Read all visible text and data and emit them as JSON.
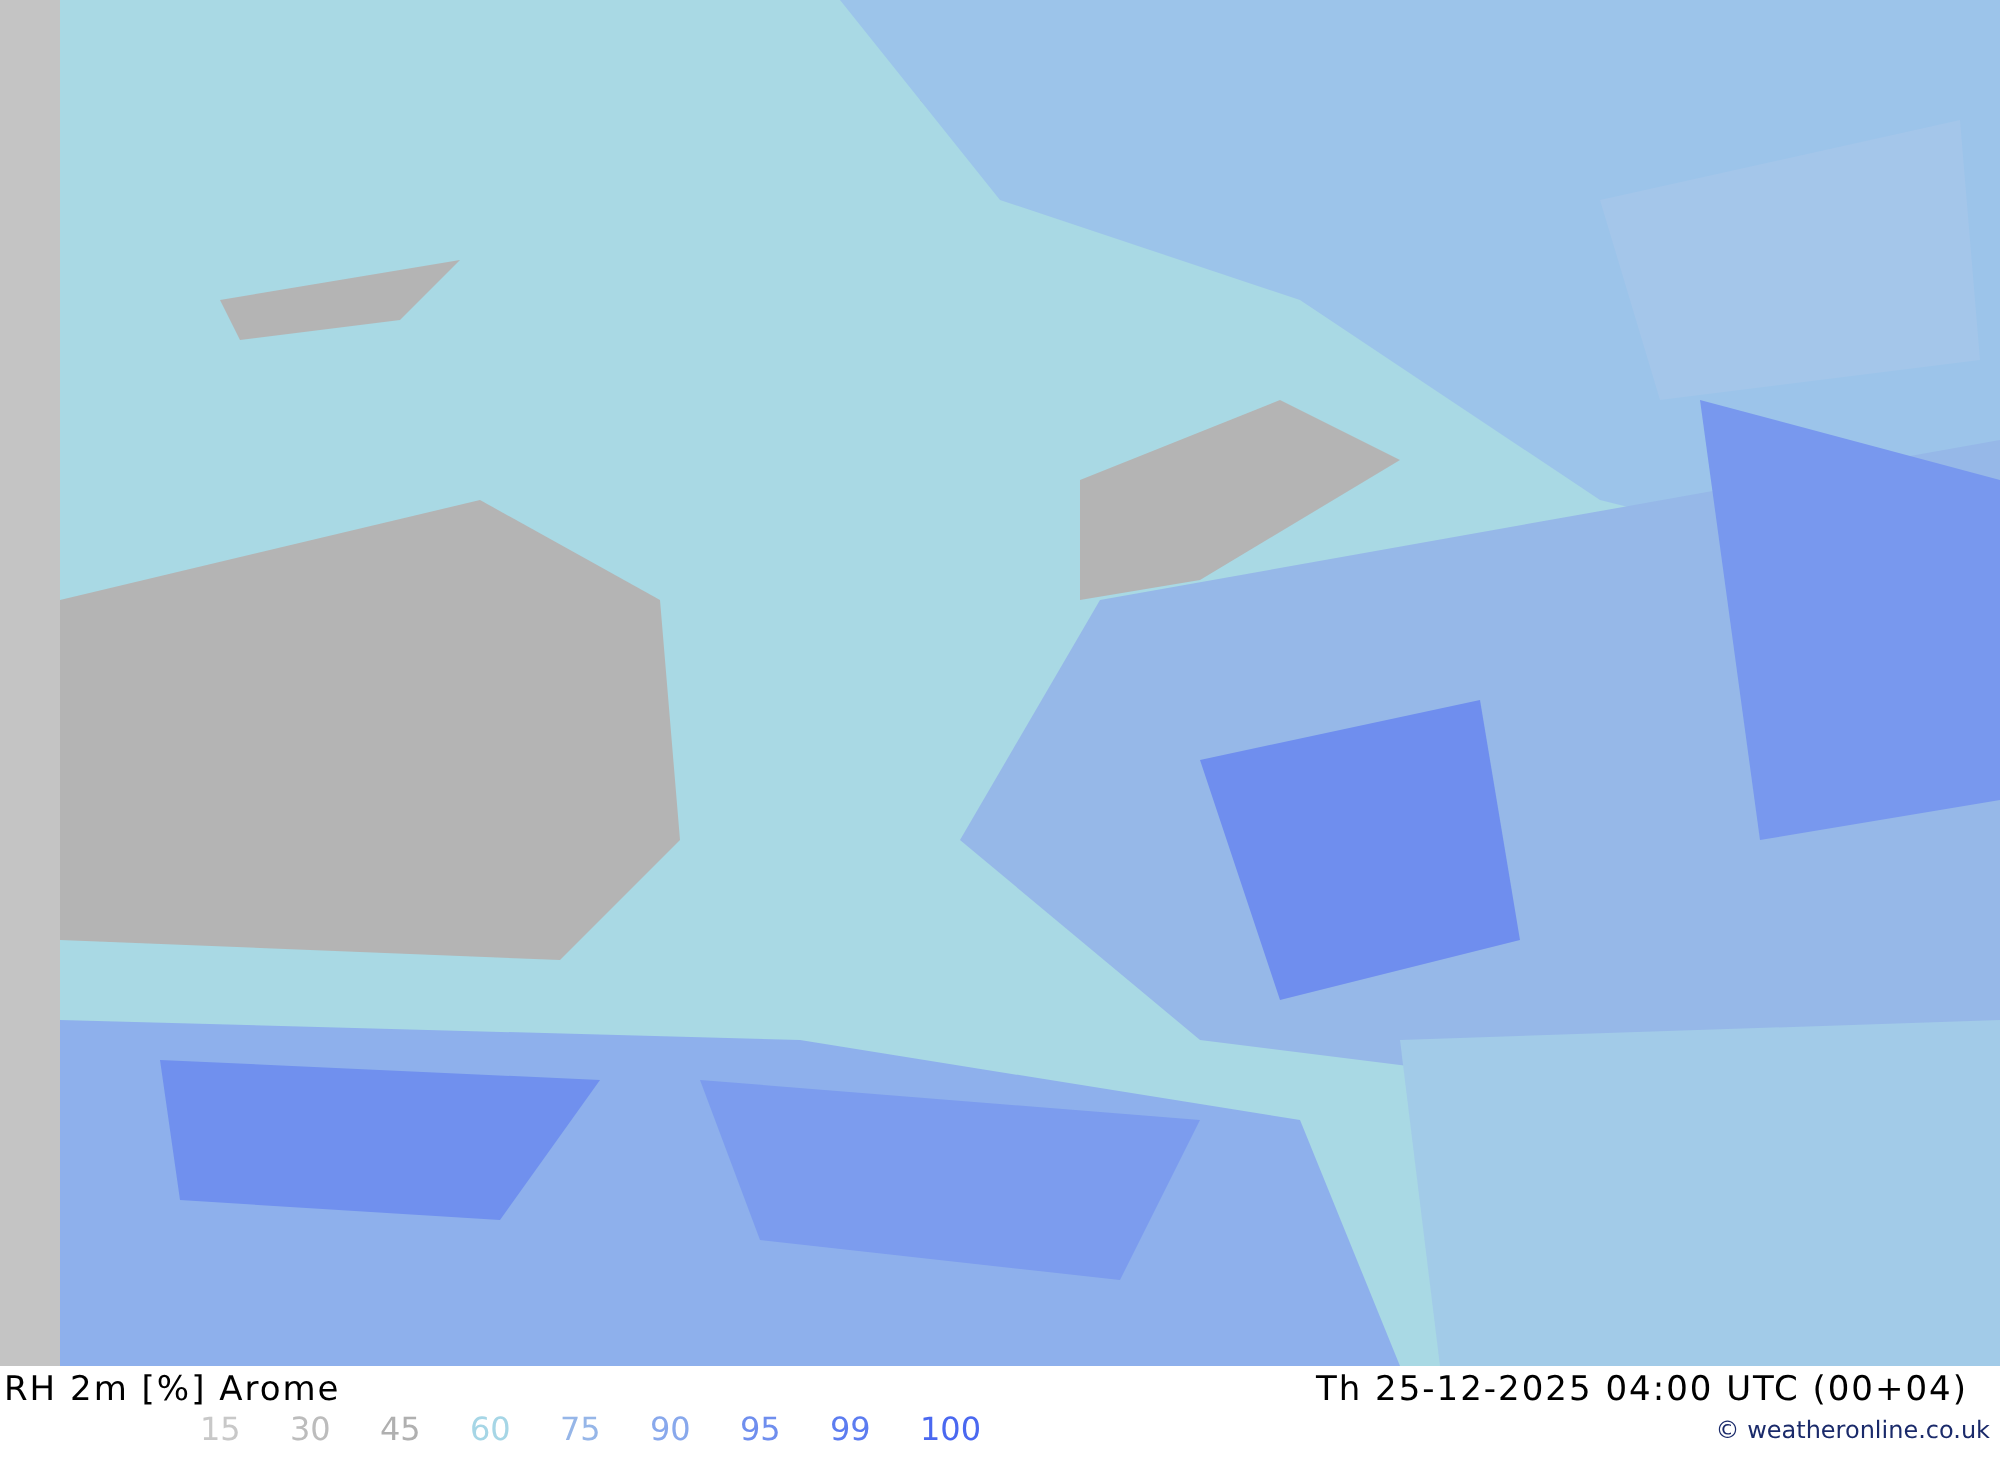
{
  "title": "RH 2m [%] Arome",
  "valid_time": "Th 25-12-2025 04:00 UTC (00+04)",
  "legend": [
    {
      "label": "15",
      "color": "#c8c8c8"
    },
    {
      "label": "30",
      "color": "#bcbcbc"
    },
    {
      "label": "45",
      "color": "#b0b0b0"
    },
    {
      "label": "60",
      "color": "#a6d6e6"
    },
    {
      "label": "75",
      "color": "#96b6e8"
    },
    {
      "label": "90",
      "color": "#88a8ec"
    },
    {
      "label": "95",
      "color": "#6f8eee"
    },
    {
      "label": "99",
      "color": "#5c7cf0"
    },
    {
      "label": "100",
      "color": "#4a68f0"
    }
  ],
  "copyright": "© weatheronline.co.uk"
}
